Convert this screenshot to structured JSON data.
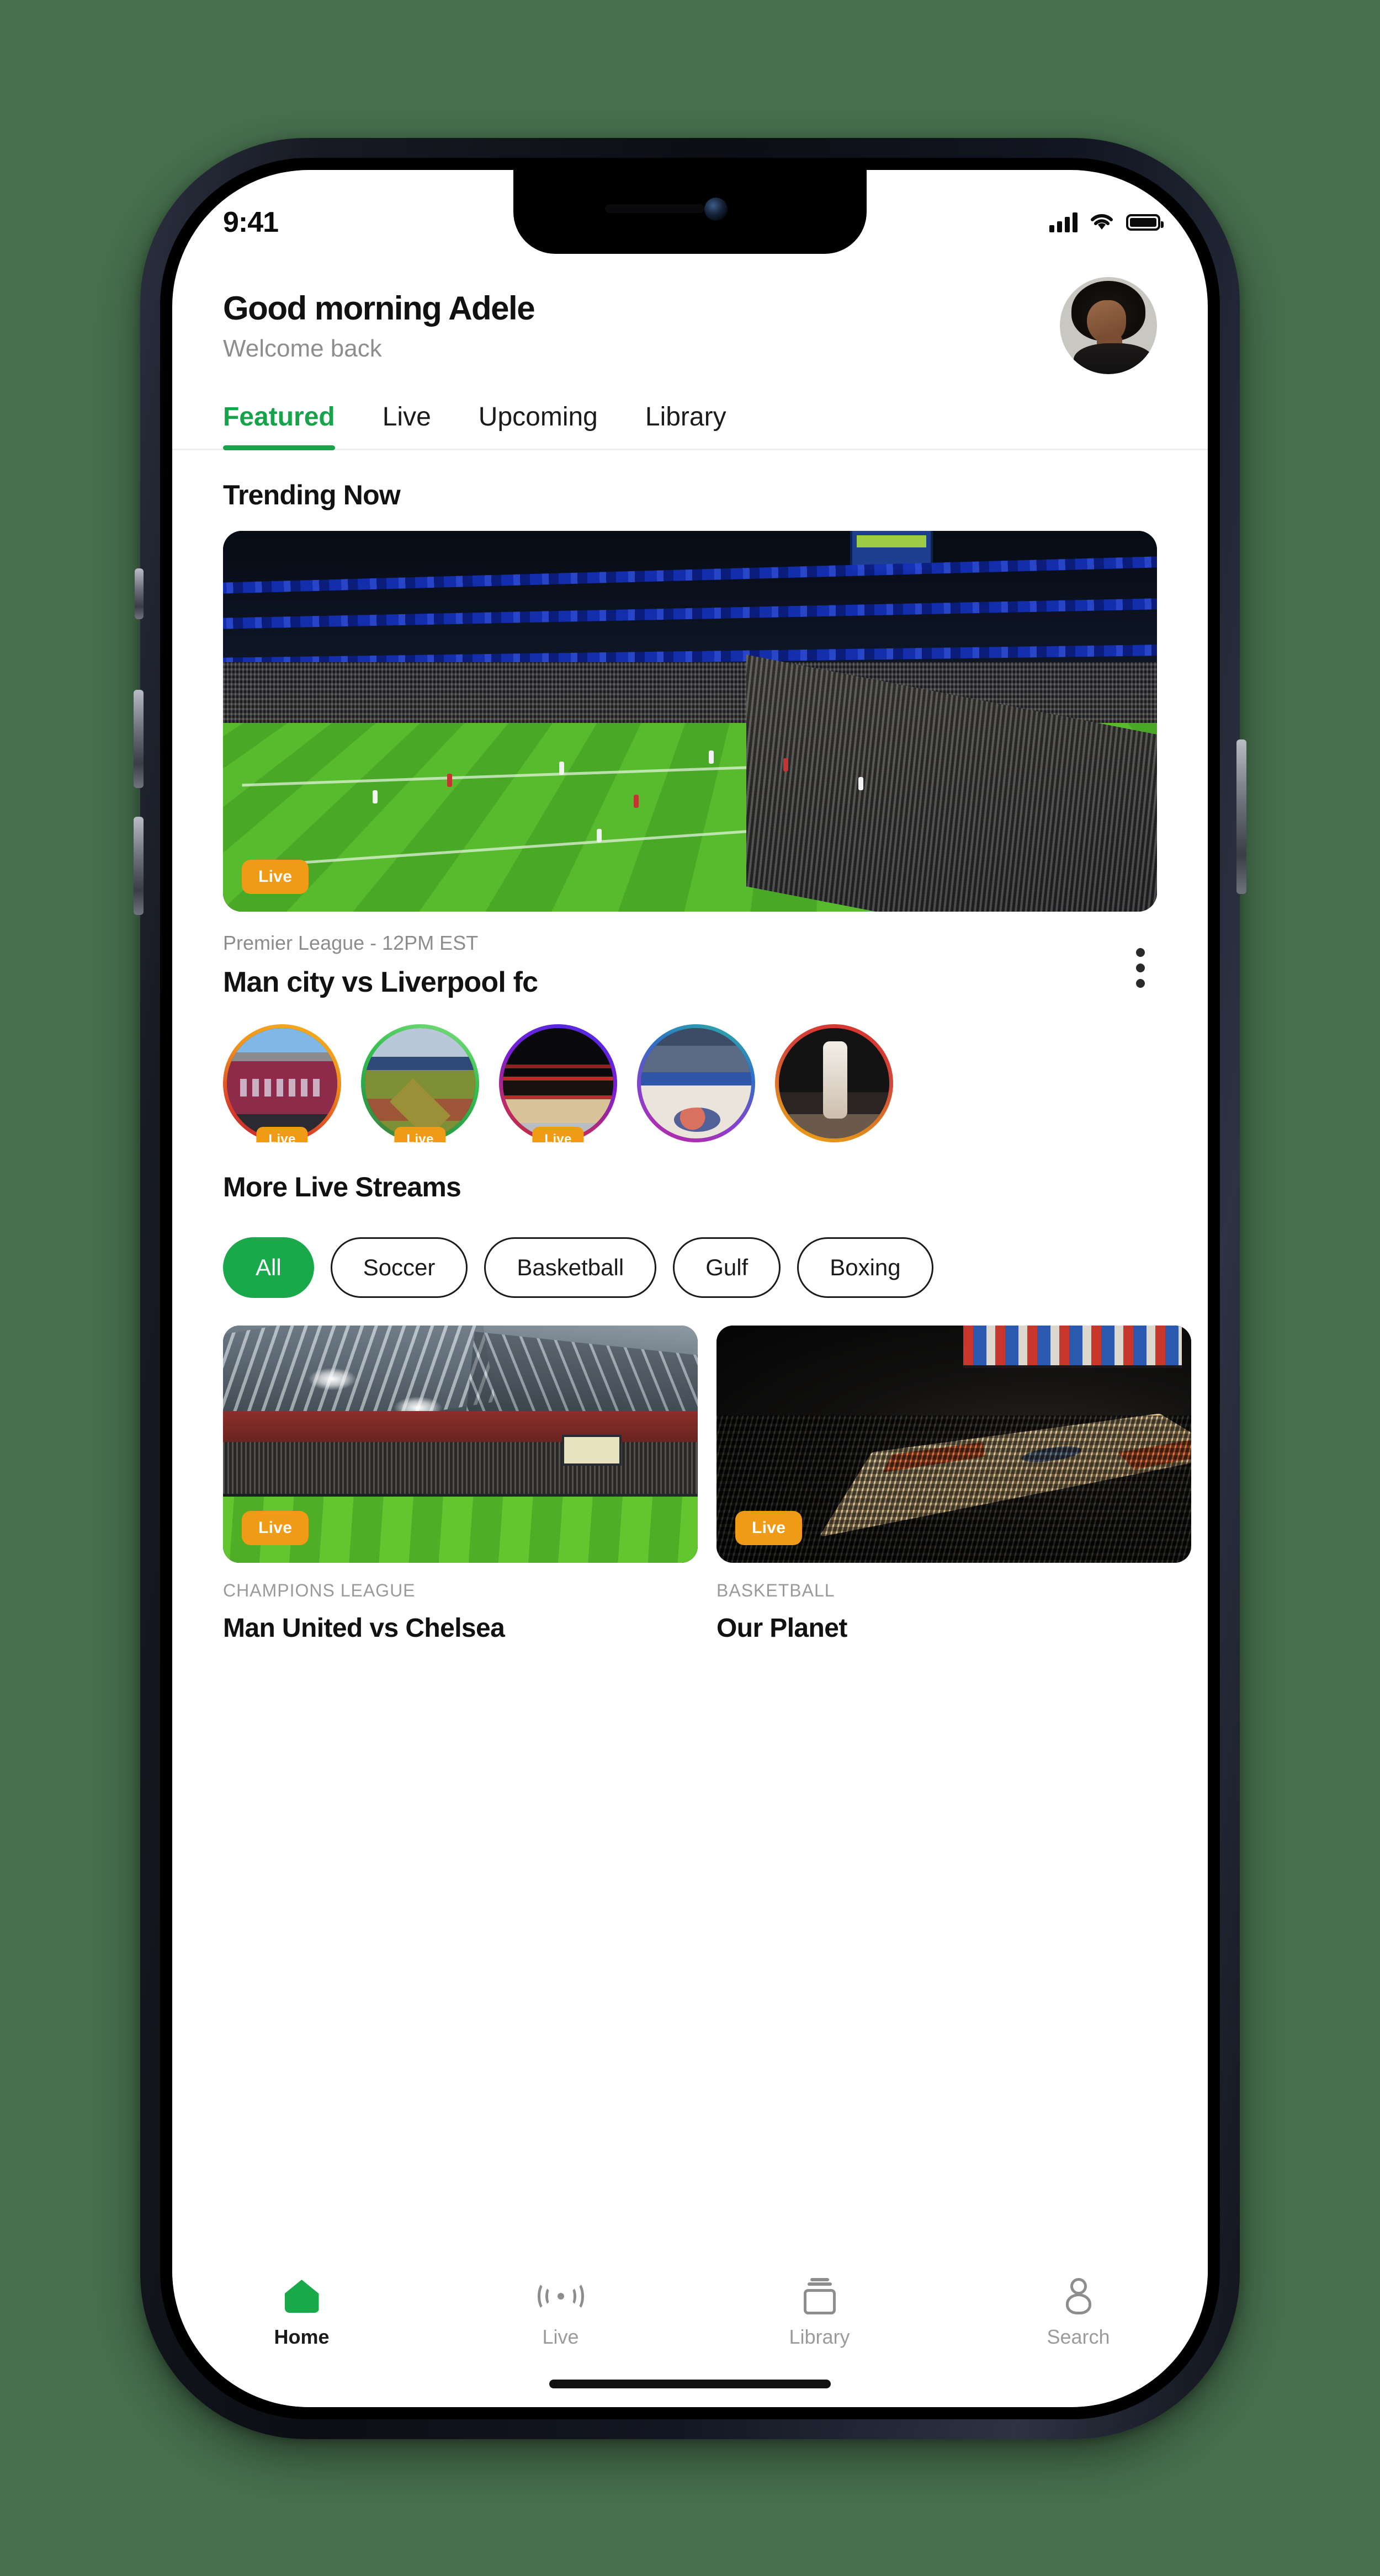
{
  "status_bar": {
    "time": "9:41",
    "signal_icon": "cellular-signal-icon",
    "wifi_icon": "wifi-icon",
    "battery_icon": "battery-full-icon"
  },
  "header": {
    "greeting": "Good morning Adele",
    "subtitle": "Welcome back",
    "avatar_alt": "user-avatar"
  },
  "tabs": {
    "active_index": 0,
    "items": [
      {
        "label": "Featured"
      },
      {
        "label": "Live"
      },
      {
        "label": "Upcoming"
      },
      {
        "label": "Library"
      }
    ]
  },
  "trending": {
    "section_title": "Trending Now",
    "hero": {
      "live_badge": "Live",
      "league": "Premier League - 12PM EST",
      "title": "Man city vs Liverpool fc",
      "menu_icon": "kebab-menu-icon"
    }
  },
  "stories": [
    {
      "name": "the-reds-stadium",
      "live_badge": "Live",
      "has_live": true,
      "ring": "linear-gradient(200deg,#f5b21c 0%,#ef8f1b 38%,#d93b2b 78%,#b9252a 100%)"
    },
    {
      "name": "baseball-field",
      "live_badge": "Live",
      "has_live": true,
      "ring": "linear-gradient(200deg,#7ee07a 0%,#34c04f 40%,#2aa049 72%,#4b7a34 100%)"
    },
    {
      "name": "boxing-ring",
      "live_badge": "Live",
      "has_live": true,
      "ring": "linear-gradient(200deg,#4b2ce8 0%,#7a1ed8 42%,#c02a66 76%,#b92b31 100%)"
    },
    {
      "name": "tennis-arena",
      "live_badge": "",
      "has_live": false,
      "ring": "linear-gradient(200deg,#2bb5a0 0%,#2f6fc9 34%,#8b3fd0 70%,#c4219b 100%)"
    },
    {
      "name": "basketball-dunk",
      "live_badge": "",
      "has_live": false,
      "ring": "linear-gradient(200deg,#d9302c 0%,#d4473a 38%,#e08a1e 76%,#efa316 100%)"
    }
  ],
  "more_live": {
    "section_title": "More Live Streams",
    "chips": [
      {
        "label": "All",
        "active": true
      },
      {
        "label": "Soccer",
        "active": false
      },
      {
        "label": "Basketball",
        "active": false
      },
      {
        "label": "Gulf",
        "active": false
      },
      {
        "label": "Boxing",
        "active": false
      }
    ],
    "cards": [
      {
        "live_badge": "Live",
        "category": "CHAMPIONS LEAGUE",
        "title": "Man United vs Chelsea",
        "art": "wembley-stadium"
      },
      {
        "live_badge": "Live",
        "category": "BASKETBALL",
        "title": "Our Planet",
        "art": "basketball-arena"
      }
    ]
  },
  "bottom_nav": {
    "active_index": 0,
    "items": [
      {
        "label": "Home",
        "icon": "home-icon"
      },
      {
        "label": "Live",
        "icon": "broadcast-icon"
      },
      {
        "label": "Library",
        "icon": "library-icon"
      },
      {
        "label": "Search",
        "icon": "person-search-icon"
      }
    ]
  },
  "theme": {
    "accent_green": "#1aa94a",
    "live_orange": "#ef9b16",
    "page_background": "#47704e",
    "text_primary": "#111111",
    "text_muted": "#8d8d8d"
  }
}
